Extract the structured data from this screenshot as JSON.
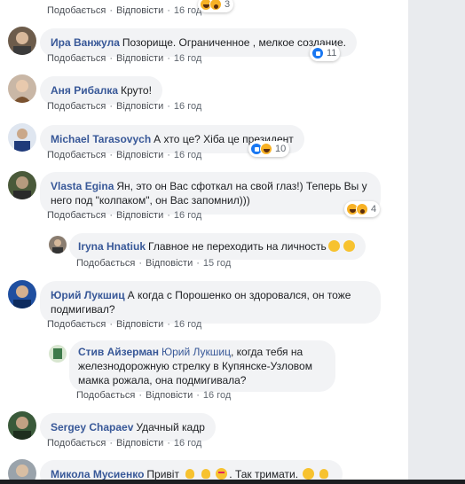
{
  "actions": {
    "like": "Подобається",
    "reply": "Відповісти",
    "dot": "·"
  },
  "colors": {
    "name": "#385898",
    "bubble": "#f2f3f5",
    "rail": "#e9ebee",
    "like": "#1877f2",
    "haha": "#f7b125"
  },
  "comments": [
    {
      "author": "",
      "text": "",
      "time": "16 год",
      "reactions": [
        "haha"
      ],
      "reaction_count": "3"
    },
    {
      "author": "Ира Ванжула",
      "text": "Позорище. Ограниченное , мелкое создание.",
      "time": "16 год",
      "reactions": [
        "like"
      ],
      "reaction_count": "11"
    },
    {
      "author": "Аня Рибалка",
      "text": "Круто!",
      "time": "16 год"
    },
    {
      "author": "Michael Tarasovych",
      "text": "А хто це? Хіба це президент",
      "time": "16 год",
      "reactions": [
        "like",
        "haha"
      ],
      "reaction_count": "10"
    },
    {
      "author": "Vlasta Egina",
      "text": "Ян, это он Вас сфоткал на свой глаз!) Теперь Вы у него под \"колпаком\", он Вас запомнил)))",
      "time": "16 год",
      "reactions": [
        "haha",
        "wow"
      ],
      "reaction_count": "4"
    },
    {
      "author": "Iryna Hnatiuk",
      "text": "Главное не переходить на личность",
      "time": "15 год"
    },
    {
      "author": "Юрий Лукшиц",
      "text": "А когда с Порошенко он здоровался, он тоже подмигивал?",
      "time": "16 год"
    },
    {
      "author": "Стив Айзерман",
      "mention": "Юрий Лукшиц",
      "text": ", когда тебя на железнодорожную стрелку в Купянске-Узловом мамка рожала, она подмигивала?",
      "time": "16 год"
    },
    {
      "author": "Sergey Chapaev",
      "text": "Удачный кадр",
      "time": "16 год"
    },
    {
      "author": "Микола Мусиенко",
      "text_1": "Привіт",
      "text_2": ". Так тримати."
    }
  ]
}
